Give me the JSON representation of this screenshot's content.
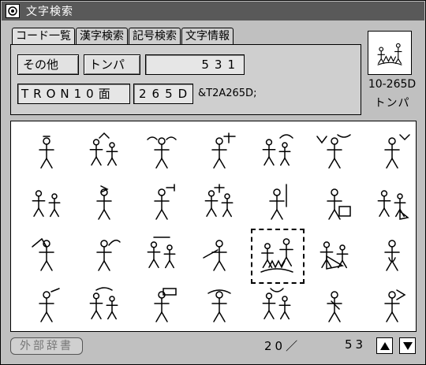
{
  "window": {
    "title": "文字検索"
  },
  "tabs": [
    {
      "label": "コード一覧",
      "active": true
    },
    {
      "label": "漢字検索",
      "active": false
    },
    {
      "label": "記号検索",
      "active": false
    },
    {
      "label": "文字情報",
      "active": false
    }
  ],
  "panel": {
    "category_button": "その他",
    "subcategory_button": "トンパ",
    "number_field": "531",
    "plane_field": "TRON10面",
    "code_field": "265D",
    "escape_text": "&T2A265D;"
  },
  "preview": {
    "code": "10-265D",
    "name": "トンパ"
  },
  "bottom": {
    "dictionary_button": "外部辞書",
    "page_current": "20／",
    "page_total": "53"
  }
}
